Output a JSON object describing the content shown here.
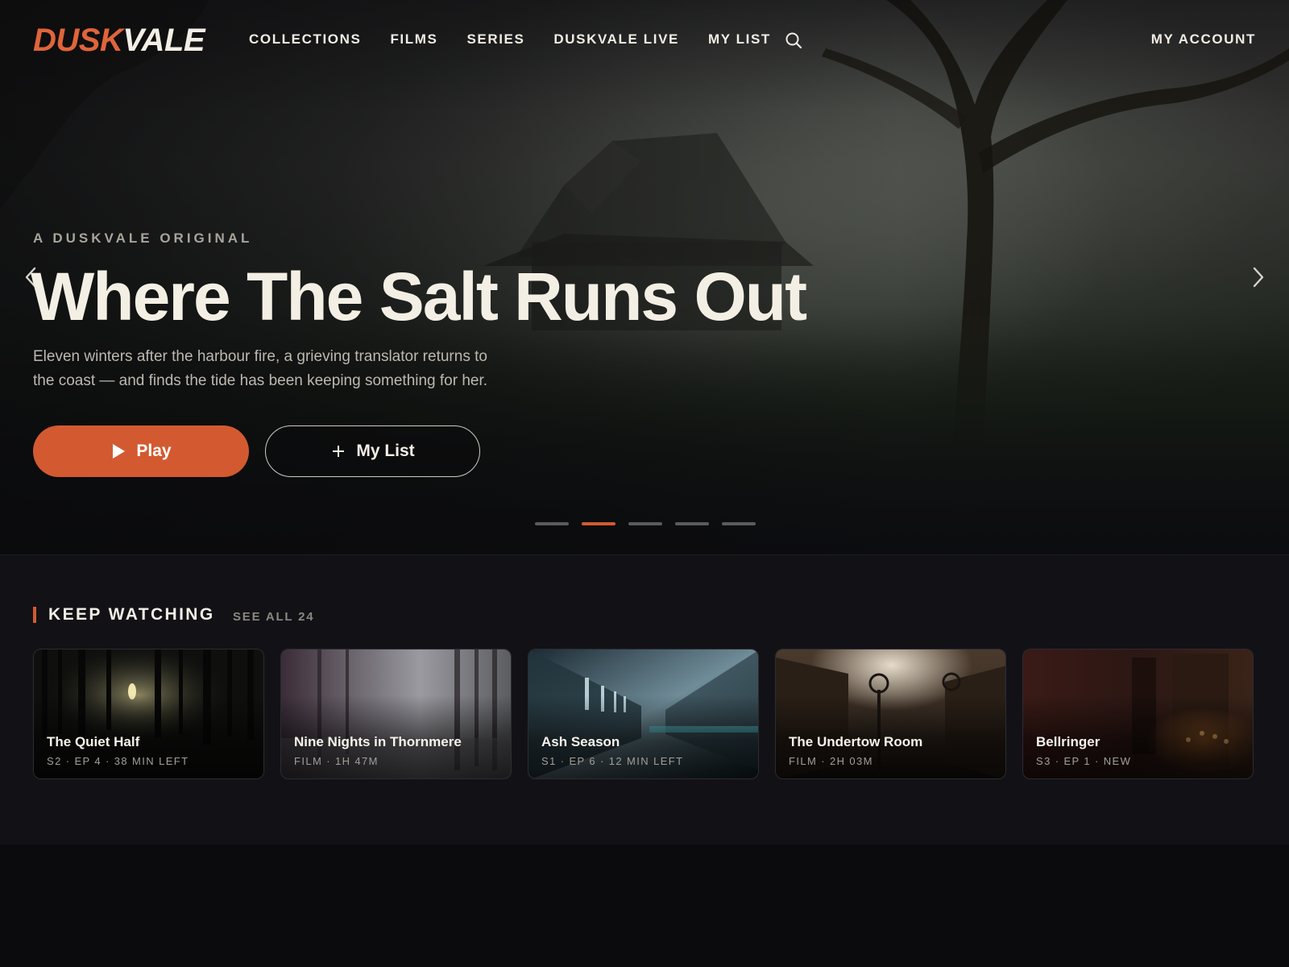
{
  "brand": {
    "logo_part1": "DUSK",
    "logo_part2": "VALE",
    "accent": "#d35a30"
  },
  "nav": {
    "links": [
      "COLLECTIONS",
      "FILMS",
      "SERIES",
      "DUSKVALE LIVE",
      "MY LIST"
    ],
    "search_icon": "search-icon",
    "account_label": "MY ACCOUNT"
  },
  "hero": {
    "eyebrow": "A DUSKVALE ORIGINAL",
    "title": "Where The Salt Runs Out",
    "synopsis_line1": "Eleven winters after the harbour fire, a grieving translator returns to",
    "synopsis_line2": "the coast — and finds the tide has been keeping something for her.",
    "play_label": "Play",
    "list_label": "My List",
    "slides_total": 5,
    "slide_active": 2
  },
  "keep_watching": {
    "title": "KEEP WATCHING",
    "see_all": "SEE ALL 24",
    "items": [
      {
        "title": "The Quiet Half",
        "meta": "S2 · EP 4 · 38 MIN LEFT"
      },
      {
        "title": "Nine Nights in Thornmere",
        "meta": "FILM · 1H 47M"
      },
      {
        "title": "Ash Season",
        "meta": "S1 · EP 6 · 12 MIN LEFT"
      },
      {
        "title": "The Undertow Room",
        "meta": "FILM · 2H 03M"
      },
      {
        "title": "Bellringer",
        "meta": "S3 · EP 1 · NEW"
      }
    ]
  }
}
